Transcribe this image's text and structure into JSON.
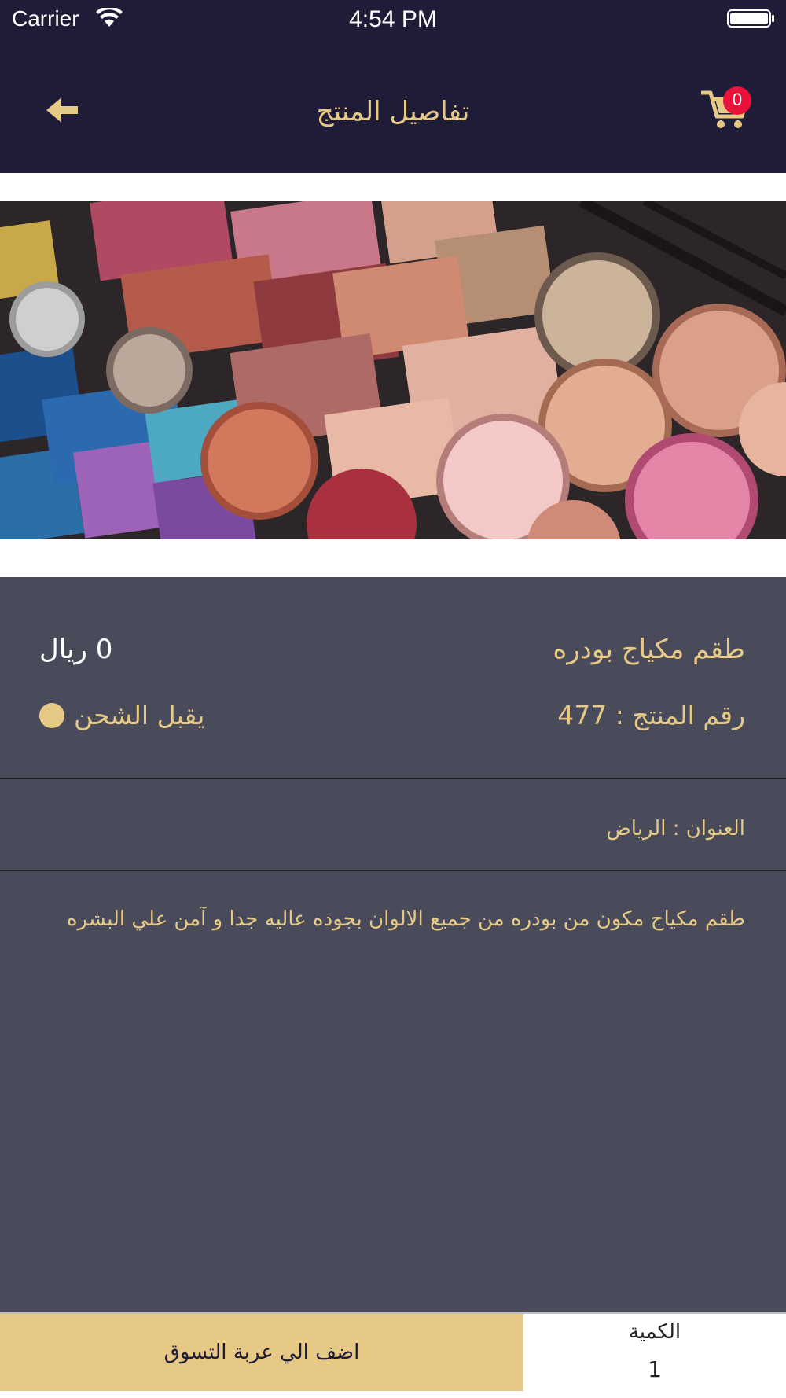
{
  "status_bar": {
    "carrier": "Carrier",
    "time": "4:54 PM"
  },
  "nav": {
    "title": "تفاصيل المنتج",
    "cart_count": "0"
  },
  "product": {
    "name": "طقم مكياج بودره",
    "price": "0 ريال",
    "code": "رقم المنتج : 477",
    "shipping": "يقبل الشحن",
    "address": "العنوان : الرياض",
    "description": "طقم مكياج مكون من بودره من جميع الالوان بجوده عاليه جدا و آمن علي البشره"
  },
  "footer": {
    "add_to_cart": "اضف الي عربة التسوق",
    "quantity_label": "الكمية",
    "quantity_value": "1"
  },
  "colors": {
    "nav_bg": "#1f1c38",
    "accent": "#e7c986",
    "panel_bg": "#494b5b",
    "badge": "#e8123b"
  }
}
